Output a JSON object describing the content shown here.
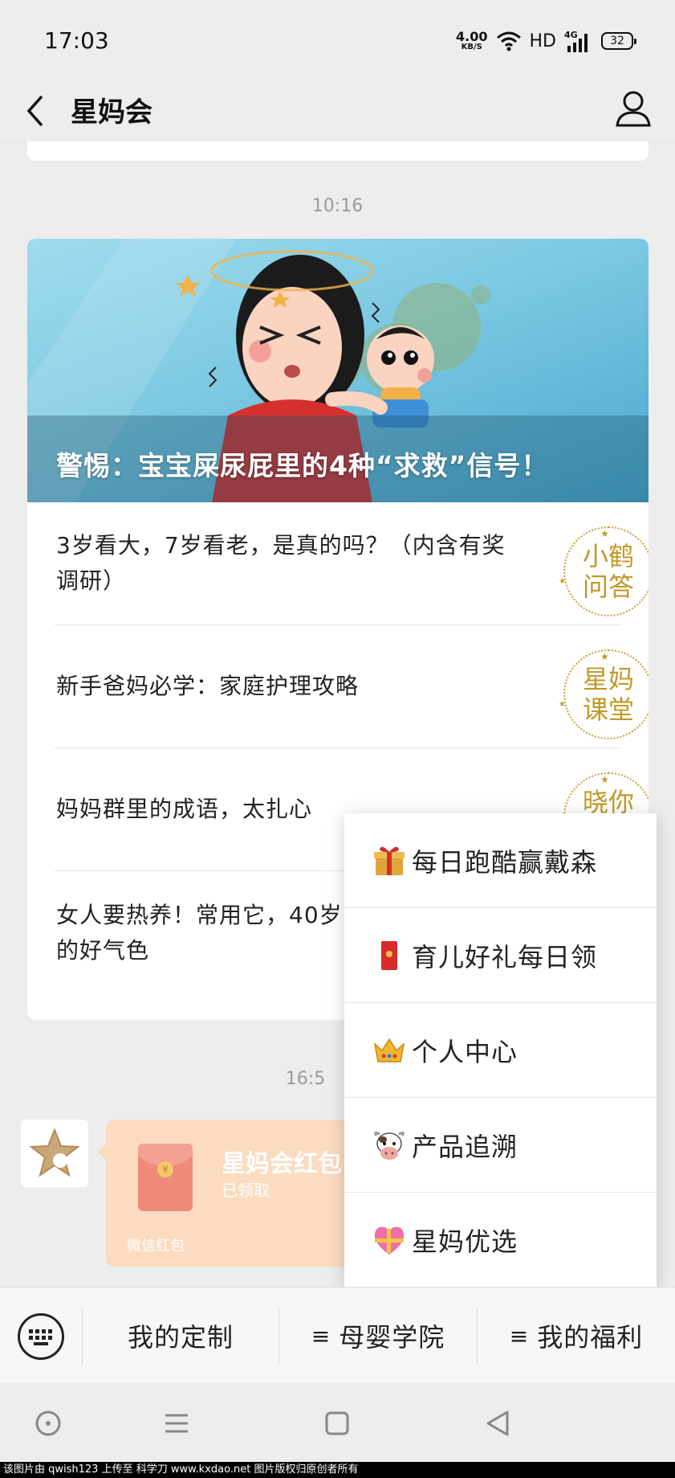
{
  "status_bar": {
    "time": "17:03",
    "speed_value": "4.00",
    "speed_unit": "KB/S",
    "hd": "HD",
    "network": "4G",
    "battery": "32"
  },
  "nav": {
    "title": "星妈会",
    "back_icon": "chevron-left-icon",
    "profile_icon": "person-icon"
  },
  "chat": {
    "time_1": "10:16",
    "article": {
      "cover_title": "警惕：宝宝屎尿屁里的4种“求救”信号！",
      "items": [
        {
          "text": "3岁看大，7岁看老，是真的吗？（内含有奖调研）",
          "badge": "小鹤问答"
        },
        {
          "text": "新手爸妈必学：家庭护理攻略",
          "badge": "星妈课堂"
        },
        {
          "text": "妈妈群里的成语，太扎心",
          "badge": "晓你聊"
        },
        {
          "text": "女人要热养！常用它，40岁的好气色",
          "badge": ""
        }
      ]
    },
    "time_2": "16:5",
    "red_packet": {
      "title": "星妈会红包",
      "status": "已领取",
      "footer": "微信红包"
    }
  },
  "popup_menu": {
    "items": [
      {
        "icon": "gift-icon",
        "label": "每日跑酷赢戴森"
      },
      {
        "icon": "red-envelope-icon",
        "label": "育儿好礼每日领"
      },
      {
        "icon": "crown-icon",
        "label": "个人中心"
      },
      {
        "icon": "cow-icon",
        "label": "产品追溯"
      },
      {
        "icon": "heart-ribbon-icon",
        "label": "星妈优选"
      }
    ]
  },
  "menu_bar": {
    "keyboard_icon": "keyboard-icon",
    "tab_1": "我的定制",
    "tab_2": "母婴学院",
    "tab_3": "我的福利",
    "hamburger": "≡"
  },
  "footer": {
    "text": "该图片由 qwish123 上传至 科学刀 www.kxdao.net 图片版权归原创者所有"
  },
  "colors": {
    "accent_gold": "#c29a28",
    "red_packet": "#fbdcc0",
    "background": "#ededed"
  }
}
